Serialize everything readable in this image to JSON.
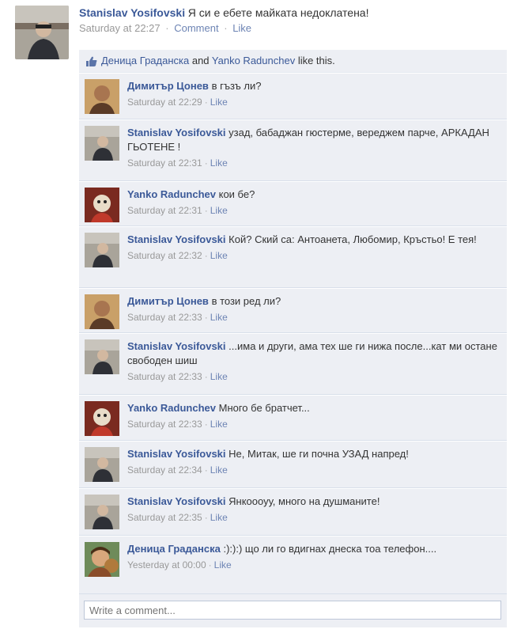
{
  "post": {
    "author": "Stanislav Yosifovski",
    "message": "Я си е ебете майката недоклатена!",
    "time": "Saturday at 22:27",
    "comment_link": "Comment",
    "like_link": "Like"
  },
  "likes": {
    "person1": "Деница Граданска",
    "and": " and ",
    "person2": "Yanko Radunchev",
    "suffix": " like this."
  },
  "separator": "·",
  "comments": [
    {
      "author": "Димитър Цонев",
      "text": "в гъзъ ли?",
      "time": "Saturday at 22:29",
      "like": "Like"
    },
    {
      "author": "Stanislav Yosifovski",
      "text": "узад, бабаджан гюстерме, вереджем парче, АРКАДАН ГЬОТЕНЕ !",
      "time": "Saturday at 22:31",
      "like": "Like"
    },
    {
      "author": "Yanko Radunchev",
      "text": "кои бе?",
      "time": "Saturday at 22:31",
      "like": "Like"
    },
    {
      "author": "Stanislav Yosifovski",
      "text": "Кой? Ский са: Антоанета, Любомир, Кръстьо! Е тея!",
      "time": "Saturday at 22:32",
      "like": "Like"
    },
    {
      "author": "Димитър Цонев",
      "text": "в този ред ли?",
      "time": "Saturday at 22:33",
      "like": "Like"
    },
    {
      "author": "Stanislav Yosifovski",
      "text": "...има и други, ама тех ше ги нижа после...кат ми остане свободен шиш",
      "time": "Saturday at 22:33",
      "like": "Like"
    },
    {
      "author": "Yanko Radunchev",
      "text": "Много бе братчет...",
      "time": "Saturday at 22:33",
      "like": "Like"
    },
    {
      "author": "Stanislav Yosifovski",
      "text": "Не, Митак, ше ги почна УЗАД напред!",
      "time": "Saturday at 22:34",
      "like": "Like"
    },
    {
      "author": "Stanislav Yosifovski",
      "text": "Янкоооуу, много на душманите!",
      "time": "Saturday at 22:35",
      "like": "Like"
    },
    {
      "author": "Деница Граданска",
      "text": ":):):) що ли го вдигнах днеска тоа телефон....",
      "time": "Yesterday at 00:00",
      "like": "Like"
    }
  ],
  "composer": {
    "placeholder": "Write a comment..."
  }
}
